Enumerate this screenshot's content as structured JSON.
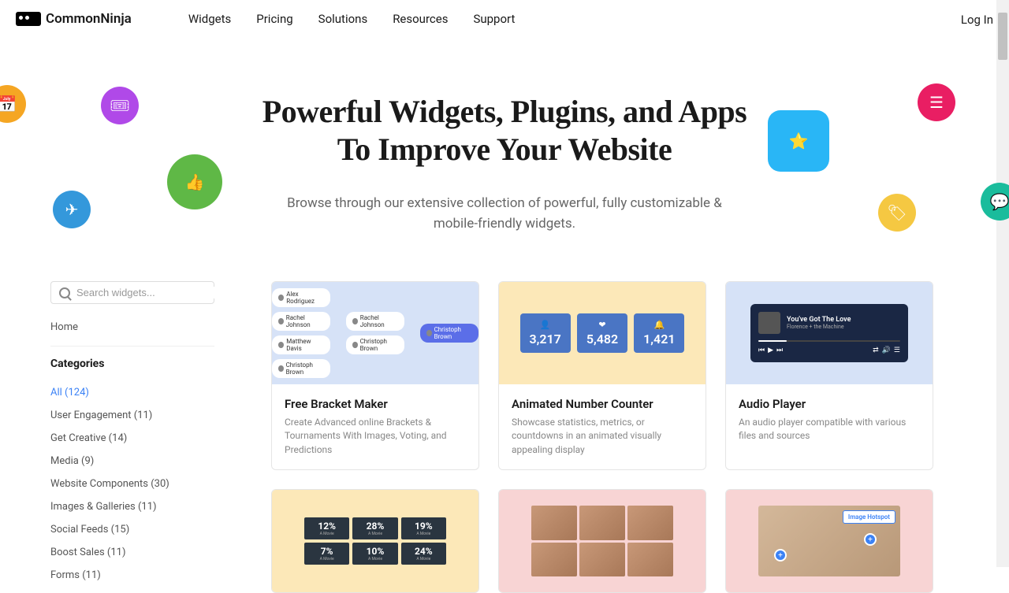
{
  "brand": "CommonNinja",
  "nav": {
    "items": [
      "Widgets",
      "Pricing",
      "Solutions",
      "Resources",
      "Support"
    ],
    "login": "Log In"
  },
  "hero": {
    "title_line1": "Powerful Widgets, Plugins, and Apps",
    "title_line2": "To Improve Your Website",
    "subtitle": "Browse through our extensive collection of powerful, fully customizable & mobile-friendly widgets."
  },
  "search": {
    "placeholder": "Search widgets..."
  },
  "sidebar": {
    "home": "Home",
    "categories_label": "Categories",
    "categories": [
      {
        "label": "All (124)",
        "active": true
      },
      {
        "label": "User Engagement (11)"
      },
      {
        "label": "Get Creative (14)"
      },
      {
        "label": "Media (9)"
      },
      {
        "label": "Website Components (30)"
      },
      {
        "label": "Images & Galleries (11)"
      },
      {
        "label": "Social Feeds (15)"
      },
      {
        "label": "Boost Sales (11)"
      },
      {
        "label": "Forms (11)"
      }
    ]
  },
  "cards": [
    {
      "title": "Free Bracket Maker",
      "desc": "Create Advanced online Brackets & Tournaments With Images, Voting, and Predictions"
    },
    {
      "title": "Animated Number Counter",
      "desc": "Showcase statistics, metrics, or countdowns in an animated visually appealing display"
    },
    {
      "title": "Audio Player",
      "desc": "An audio player compatible with various files and sources"
    }
  ],
  "bracket": {
    "col1": [
      "Alex Rodriguez",
      "Rachel Johnson",
      "Matthew Davis",
      "Christoph Brown"
    ],
    "col2": [
      "Rachel Johnson",
      "Christoph Brown"
    ],
    "winner": "Christoph Brown"
  },
  "counter": {
    "boxes": [
      {
        "icon": "👤",
        "num": "3,217"
      },
      {
        "icon": "❤",
        "num": "5,482"
      },
      {
        "icon": "🔔",
        "num": "1,421"
      }
    ]
  },
  "audio": {
    "title": "You've Got The Love",
    "artist": "Florence + the Machine"
  },
  "before_after": {
    "cells": [
      {
        "pct": "12%",
        "lbl": "A Movie"
      },
      {
        "pct": "28%",
        "lbl": "A Movie"
      },
      {
        "pct": "19%",
        "lbl": "A Movie"
      },
      {
        "pct": "7%",
        "lbl": "A Movie"
      },
      {
        "pct": "10%",
        "lbl": "A Movie"
      },
      {
        "pct": "24%",
        "lbl": "A Movie"
      }
    ]
  },
  "hotspot": {
    "label": "Image Hotspot"
  }
}
